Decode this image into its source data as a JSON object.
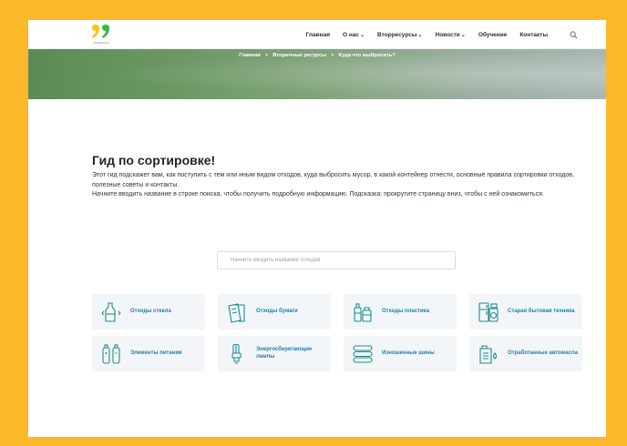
{
  "nav": {
    "items": [
      {
        "label": "Главная",
        "caret": false
      },
      {
        "label": "О нас",
        "caret": true
      },
      {
        "label": "Вторресурсы",
        "caret": true
      },
      {
        "label": "Новости",
        "caret": true
      },
      {
        "label": "Обучение",
        "caret": false
      },
      {
        "label": "Контакты",
        "caret": false
      }
    ],
    "search_icon": "search-icon"
  },
  "breadcrumb": {
    "items": [
      "Главная",
      "Вторичные ресурсы",
      "Куда что выбросить?"
    ],
    "separator": ">"
  },
  "main": {
    "title": "Гид по сортировке!",
    "description_1": "Этот гид подскажет вам, как поступить с тем или иным видом отходов, куда выбросить мусор, в какой контейнер отнести, основные правила сортировки отходов, полезные советы и контакты.",
    "description_2": "Начните вводить название в строке поиска, чтобы получить подробную информацию. Подсказка: прокрутите страницу вниз, чтобы с ней ознакомиться."
  },
  "search": {
    "placeholder": "Начните вводить название отходов",
    "value": ""
  },
  "categories": [
    {
      "label": "Отходы стекла",
      "icon": "glass-bottle-icon"
    },
    {
      "label": "Отходы бумаги",
      "icon": "paper-icon"
    },
    {
      "label": "Отходы пластика",
      "icon": "plastic-bottle-icon"
    },
    {
      "label": "Старая бытовая техника",
      "icon": "appliance-icon"
    },
    {
      "label": "Элементы питания",
      "icon": "battery-icon"
    },
    {
      "label": "Энергосберегающие лампы",
      "icon": "lamp-icon"
    },
    {
      "label": "Изношенные шины",
      "icon": "tire-icon"
    },
    {
      "label": "Отработанные автомасла",
      "icon": "oil-canister-icon"
    }
  ],
  "colors": {
    "frame_background": "#FBB82A",
    "accent_link": "#1C7FB3",
    "icon_teal": "#1A8C8F",
    "logo_yellow": "#F5C518",
    "logo_green": "#39B54A"
  }
}
